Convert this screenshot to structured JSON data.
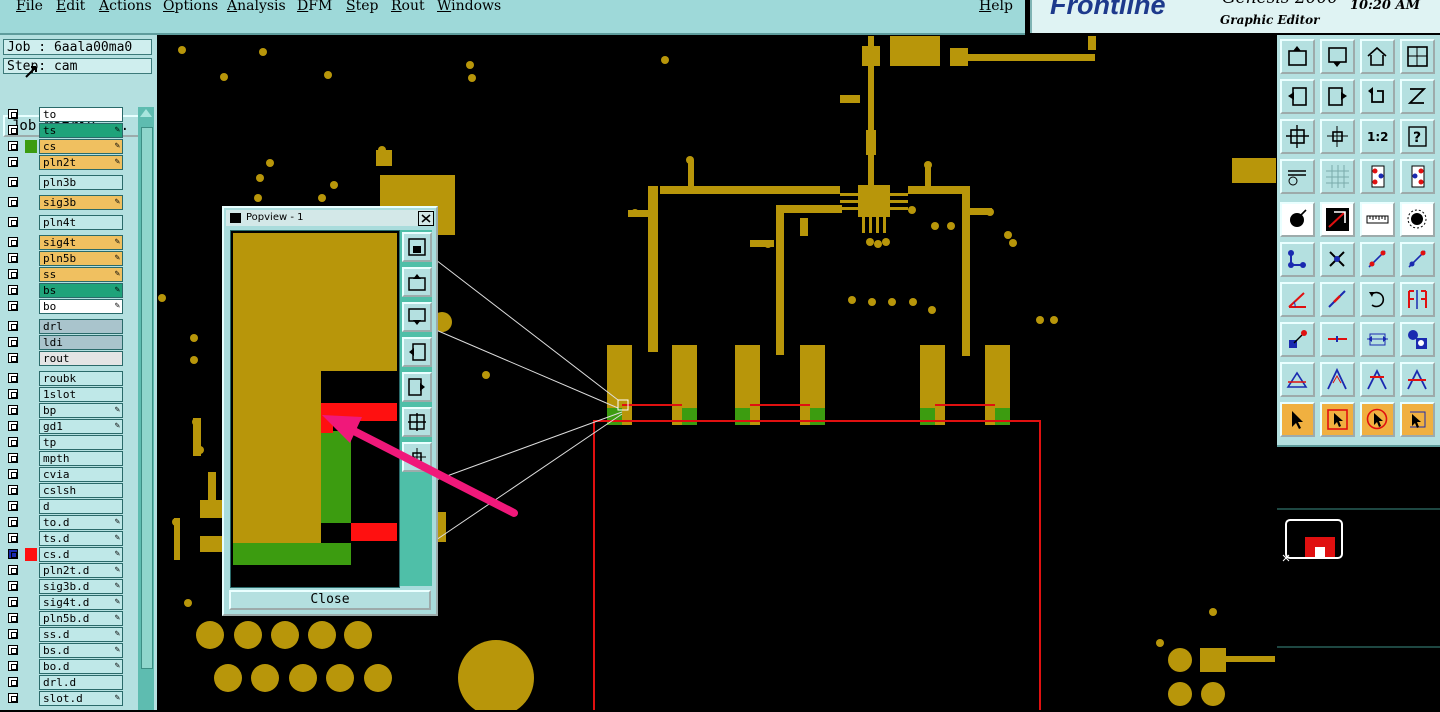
{
  "menu": {
    "items": [
      "File",
      "Edit",
      "Actions",
      "Options",
      "Analysis",
      "DFM",
      "Step",
      "Rout",
      "Windows"
    ],
    "help": "Help"
  },
  "brand": {
    "logo": "Frontline",
    "product": "Genesis 2000",
    "subtitle": "Graphic Editor",
    "time": "10:20 AM"
  },
  "job": {
    "job_label": "Job : 6aala00ma0",
    "step_label": "Step: cam",
    "matrix_button": "Job Matrix ..."
  },
  "layers": [
    {
      "name": "to",
      "color": "#ffffff"
    },
    {
      "name": "ts",
      "color": "#1fa37a"
    },
    {
      "name": "cs",
      "color": "#f0c060"
    },
    {
      "name": "pln2t",
      "color": "#f0c060"
    },
    {
      "name": "pln3b",
      "color": "#bfe8e8"
    },
    {
      "name": "sig3b",
      "color": "#f0c060"
    },
    {
      "name": "pln4t",
      "color": "#bfe8e8"
    },
    {
      "name": "sig4t",
      "color": "#f0c060"
    },
    {
      "name": "pln5b",
      "color": "#f0c060"
    },
    {
      "name": "ss",
      "color": "#f0c060"
    },
    {
      "name": "bs",
      "color": "#1fa37a"
    },
    {
      "name": "bo",
      "color": "#ffffff"
    },
    {
      "name": "drl",
      "color": "#a9c4cc"
    },
    {
      "name": "ldi",
      "color": "#a9c4cc"
    },
    {
      "name": "rout",
      "color": "#e4e4e4"
    },
    {
      "name": "roubk",
      "color": "#bfe8e8"
    },
    {
      "name": "1slot",
      "color": "#bfe8e8"
    },
    {
      "name": "bp",
      "color": "#bfe8e8"
    },
    {
      "name": "gd1",
      "color": "#bfe8e8"
    },
    {
      "name": "tp",
      "color": "#bfe8e8"
    },
    {
      "name": "mpth",
      "color": "#bfe8e8"
    },
    {
      "name": "cvia",
      "color": "#bfe8e8"
    },
    {
      "name": "cslsh",
      "color": "#bfe8e8"
    },
    {
      "name": "d",
      "color": "#bfe8e8"
    },
    {
      "name": "to.d",
      "color": "#bfe8e8"
    },
    {
      "name": "ts.d",
      "color": "#bfe8e8"
    },
    {
      "name": "cs.d",
      "color": "#bfe8e8"
    },
    {
      "name": "pln2t.d",
      "color": "#bfe8e8"
    },
    {
      "name": "sig3b.d",
      "color": "#bfe8e8"
    },
    {
      "name": "sig4t.d",
      "color": "#bfe8e8"
    },
    {
      "name": "pln5b.d",
      "color": "#bfe8e8"
    },
    {
      "name": "ss.d",
      "color": "#bfe8e8"
    },
    {
      "name": "bs.d",
      "color": "#bfe8e8"
    },
    {
      "name": "bo.d",
      "color": "#bfe8e8"
    },
    {
      "name": "drl.d",
      "color": "#bfe8e8"
    },
    {
      "name": "slot.d",
      "color": "#bfe8e8"
    }
  ],
  "popview": {
    "title": "Popview - 1",
    "close_button": "Close"
  },
  "colors": {
    "copper": "#b8960a",
    "board_outline": "#e01010",
    "mask_green": "#3c9c10",
    "highlight_red": "#ff1010",
    "pointer_arrow": "#f0187a",
    "panel_bg": "#b4e0e0"
  },
  "toolbar_icons": [
    "zoom-home-icon",
    "zoom-back-icon",
    "home-icon",
    "window-split-icon",
    "pan-left-icon",
    "pan-right-icon",
    "undo-icon",
    "redraw-icon",
    "zoom-fit-icon",
    "center-icon",
    "scale-1-2-icon",
    "help-icon",
    "measure-tools-icon",
    "grid-icon",
    "layer-stack-icon",
    "layer-stack-alt-icon",
    "pad-icon",
    "draw-line-icon",
    "ruler-icon",
    "circle-pad-icon",
    "connect-nodes-icon",
    "move-icon",
    "route-icon",
    "route-alt-icon",
    "angle-icon",
    "diagonal-icon",
    "rotate-icon",
    "mirror-icon",
    "snap-icon",
    "line-red-icon",
    "align-icon",
    "pattern-icon",
    "triangle-icon",
    "triangle-up-icon",
    "triangle-mark-icon",
    "triangle-split-icon",
    "select-arrow-icon",
    "select-box-icon",
    "select-circle-icon",
    "select-net-icon"
  ]
}
